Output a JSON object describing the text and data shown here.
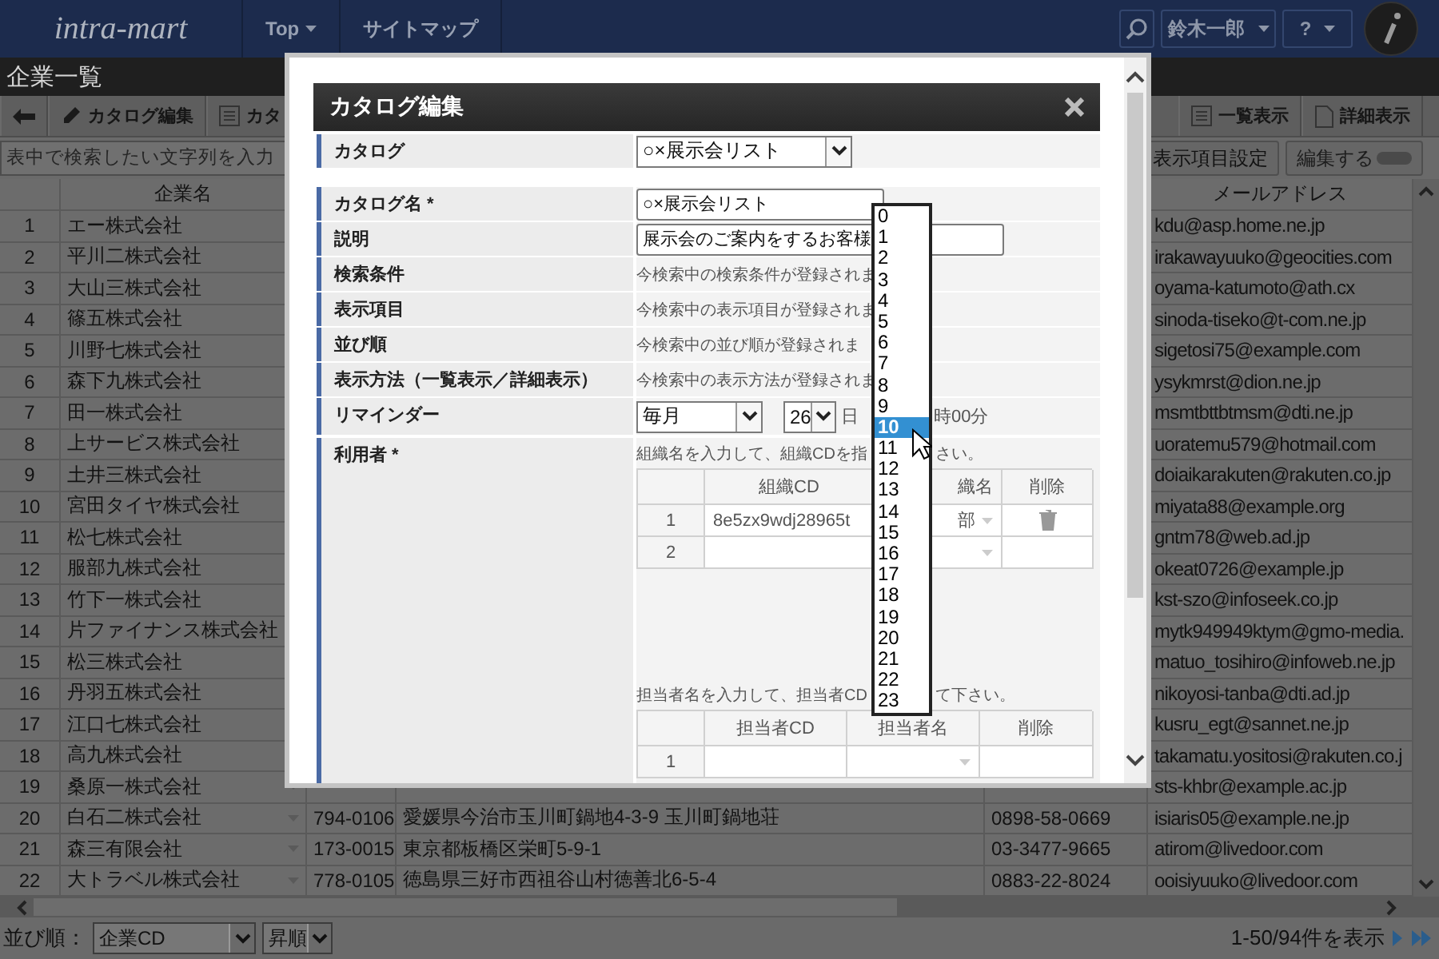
{
  "header": {
    "logo": "intra-mart",
    "nav": [
      {
        "label": "Top",
        "menu": true
      },
      {
        "label": "サイトマップ",
        "menu": false
      }
    ],
    "user": "鈴木一郎",
    "help": "?"
  },
  "page_title": "企業一覧",
  "toolbar": {
    "left": [
      {
        "kind": "back"
      },
      {
        "kind": "edit",
        "label": "カタログ編集"
      },
      {
        "kind": "list",
        "label": "カタ"
      }
    ],
    "right": [
      {
        "kind": "list",
        "label": "一覧表示"
      },
      {
        "kind": "detail",
        "label": "詳細表示"
      }
    ]
  },
  "search": {
    "placeholder": "表中で検索したい文字列を入力"
  },
  "columns_button": "表示項目設定",
  "edit_toggle": {
    "label": "編集する",
    "on": false
  },
  "table": {
    "columns": [
      "企業名",
      "メールアドレス"
    ],
    "rows": [
      {
        "no": "1",
        "name": "エー株式会社",
        "email": "kdu@asp.home.ne.jp"
      },
      {
        "no": "2",
        "name": "平川二株式会社",
        "email": "irakawayuuko@geocities.com"
      },
      {
        "no": "3",
        "name": "大山三株式会社",
        "email": "oyama-katumoto@ath.cx"
      },
      {
        "no": "4",
        "name": "篠五株式会社",
        "email": "sinoda-tiseko@t-com.ne.jp"
      },
      {
        "no": "5",
        "name": "川野七株式会社",
        "email": "sigetosi75@example.com"
      },
      {
        "no": "6",
        "name": "森下九株式会社",
        "email": "ysykmrst@dion.ne.jp"
      },
      {
        "no": "7",
        "name": "田一株式会社",
        "email": "msmtbttbtmsm@dti.ne.jp"
      },
      {
        "no": "8",
        "name": "上サービス株式会社",
        "email": "uoratemu579@hotmail.com"
      },
      {
        "no": "9",
        "name": "土井三株式会社",
        "email": "doiaikarakuten@rakuten.co.jp"
      },
      {
        "no": "10",
        "name": "宮田タイヤ株式会社",
        "email": "miyata88@example.org"
      },
      {
        "no": "11",
        "name": "松七株式会社",
        "email": "gntm78@web.ad.jp"
      },
      {
        "no": "12",
        "name": "服部九株式会社",
        "email": "okeat0726@example.jp"
      },
      {
        "no": "13",
        "name": "竹下一株式会社",
        "email": "kst-szo@infoseek.co.jp"
      },
      {
        "no": "14",
        "name": "片ファイナンス株式会社",
        "email": "mytk949949ktym@gmo-media."
      },
      {
        "no": "15",
        "name": "松三株式会社",
        "email": "matuo_tosihiro@infoweb.ne.jp"
      },
      {
        "no": "16",
        "name": "丹羽五株式会社",
        "email": "nikoyosi-tanba@dti.ad.jp"
      },
      {
        "no": "17",
        "name": "江口七株式会社",
        "email": "kusru_egt@sannet.ne.jp"
      },
      {
        "no": "18",
        "name": "高九株式会社",
        "email": "takamatu.yositosi@rakuten.co.j"
      },
      {
        "no": "19",
        "name": "桑原一株式会社",
        "email": "sts-khbr@example.ac.jp"
      },
      {
        "no": "20",
        "name": "白石二株式会社",
        "postal": "794-0106",
        "address": "愛媛県今治市玉川町鍋地4-3-9 玉川町鍋地荘",
        "phone": "0898-58-0669",
        "email": "isiaris05@example.ne.jp"
      },
      {
        "no": "21",
        "name": "森三有限会社",
        "postal": "173-0015",
        "address": "東京都板橋区栄町5-9-1",
        "phone": "03-3477-9665",
        "email": "atirom@livedoor.com"
      },
      {
        "no": "22",
        "name": "大トラベル株式会社",
        "postal": "778-0105",
        "address": "徳島県三好市西祖谷山村徳善北6-5-4",
        "phone": "0883-22-8024",
        "email": "ooisiyuuko@livedoor.com"
      }
    ]
  },
  "footer": {
    "sort_label": "並び順：",
    "sort_field": "企業CD",
    "sort_order": "昇順",
    "paging": "1-50/94件を表示"
  },
  "dialog": {
    "title": "カタログ編集",
    "catalog": {
      "label": "カタログ",
      "value": "○×展示会リスト"
    },
    "fields": [
      {
        "kind": "input",
        "label": "カタログ名 *",
        "value": "○×展示会リスト"
      },
      {
        "kind": "input",
        "label": "説明",
        "value": "展示会のご案内をするお客様"
      },
      {
        "kind": "text",
        "label": "検索条件",
        "value": "今検索中の検索条件が登録されま"
      },
      {
        "kind": "text",
        "label": "表示項目",
        "value": "今検索中の表示項目が登録されま"
      },
      {
        "kind": "text",
        "label": "並び順",
        "value": "今検索中の並び順が登録されま"
      },
      {
        "kind": "text",
        "label": "表示方法（一覧表示／詳細表示）",
        "value": "今検索中の表示方法が登録されま"
      },
      {
        "kind": "reminder",
        "label": "リマインダー",
        "period": "毎月",
        "day": "26",
        "day_unit": "日",
        "time_suffix": "時00分"
      },
      {
        "kind": "users",
        "label": "利用者 *",
        "org_hint": "組織名を入力して、組織CDを指",
        "org_hint_tail": "さい。",
        "org_table": {
          "columns": [
            "組織CD",
            "織名",
            "削除"
          ],
          "rows": [
            {
              "no": "1",
              "code": "8e5zx9wdj28965t",
              "name": "部"
            },
            {
              "no": "2"
            }
          ]
        },
        "person_hint": "担当者名を入力して、担当者CD",
        "person_hint_tail": "て下さい。",
        "person_table": {
          "columns": [
            "担当者CD",
            "担当者名",
            "削除"
          ],
          "rows": [
            {
              "no": "1"
            }
          ]
        }
      }
    ],
    "hour_options": [
      {
        "label": "0",
        "selected": false
      },
      {
        "label": "1",
        "selected": false
      },
      {
        "label": "2",
        "selected": false
      },
      {
        "label": "3",
        "selected": false
      },
      {
        "label": "4",
        "selected": false
      },
      {
        "label": "5",
        "selected": false
      },
      {
        "label": "6",
        "selected": false
      },
      {
        "label": "7",
        "selected": false
      },
      {
        "label": "8",
        "selected": false
      },
      {
        "label": "9",
        "selected": false
      },
      {
        "label": "10",
        "selected": true
      },
      {
        "label": "11",
        "selected": false
      },
      {
        "label": "12",
        "selected": false
      },
      {
        "label": "13",
        "selected": false
      },
      {
        "label": "14",
        "selected": false
      },
      {
        "label": "15",
        "selected": false
      },
      {
        "label": "16",
        "selected": false
      },
      {
        "label": "17",
        "selected": false
      },
      {
        "label": "18",
        "selected": false
      },
      {
        "label": "19",
        "selected": false
      },
      {
        "label": "20",
        "selected": false
      },
      {
        "label": "21",
        "selected": false
      },
      {
        "label": "22",
        "selected": false
      },
      {
        "label": "23",
        "selected": false
      }
    ]
  }
}
